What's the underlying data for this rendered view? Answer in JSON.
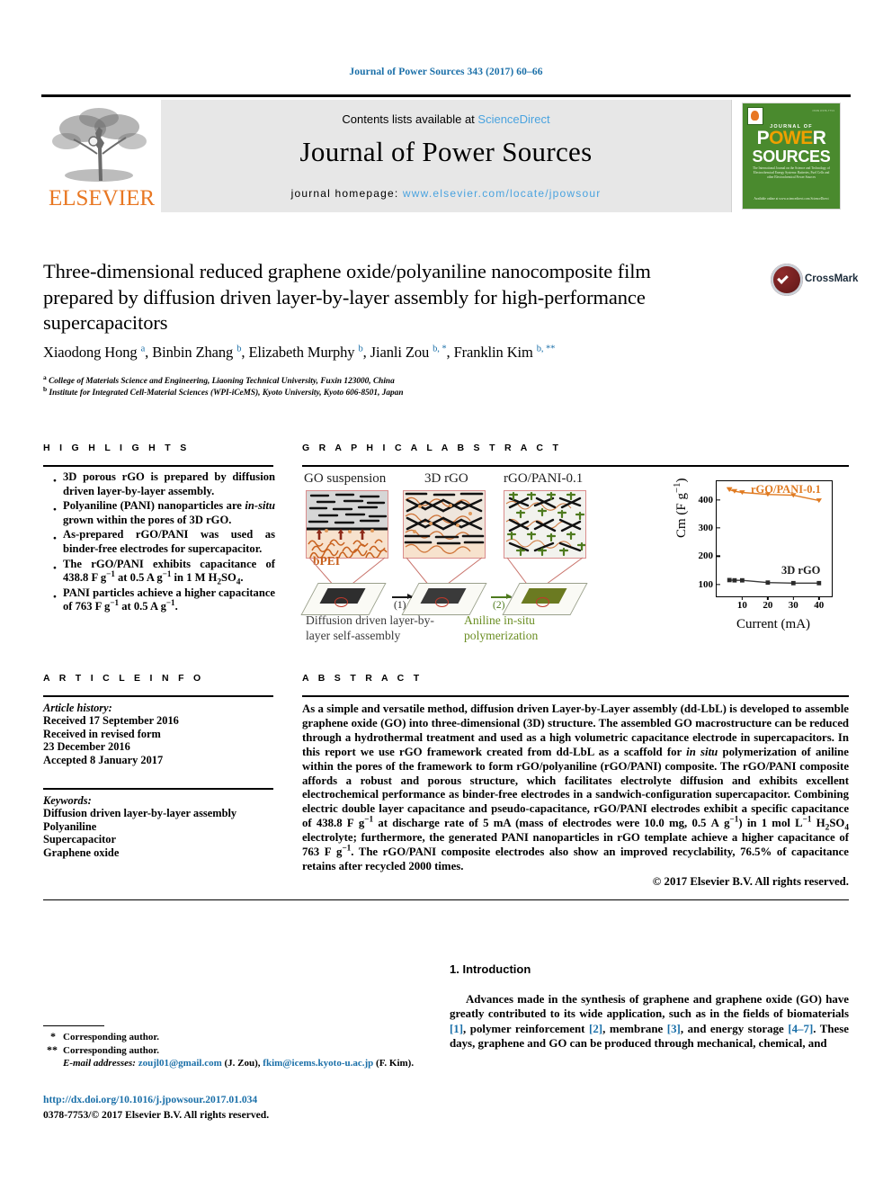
{
  "running_head": "Journal of Power Sources 343 (2017) 60–66",
  "masthead": {
    "publisher_name": "ELSEVIER",
    "contents_prefix": "Contents lists available at ",
    "contents_link": "ScienceDirect",
    "journal_title": "Journal of Power Sources",
    "homepage_prefix": "journal homepage: ",
    "homepage_url": "www.elsevier.com/locate/jpowsour",
    "cover": {
      "top_note": "ISSN 0378-7753",
      "journal_of": "JOURNAL OF",
      "power": "POWER",
      "power_w1": "P",
      "power_w2": "OWE",
      "power_w3": "R",
      "sources": "SOURCES",
      "blurb": "The International Journal on the Science and Technology of Electrochemical Energy Systems: Batteries, Fuel Cells and other Electrochemical Power Sources",
      "foot": "Available online at www.sciencedirect.com ScienceDirect"
    }
  },
  "article": {
    "title": "Three-dimensional reduced graphene oxide/polyaniline nanocomposite film prepared by diffusion driven layer-by-layer assembly for high-performance supercapacitors",
    "authors_html": "Xiaodong Hong <sup>a</sup>, Binbin Zhang <sup>b</sup>, Elizabeth Murphy <sup>b</sup>, Jianli Zou <sup>b, *</sup>, Franklin Kim <sup>b, **</sup>",
    "affiliation_a": "College of Materials Science and Engineering, Liaoning Technical University, Fuxin 123000, China",
    "affiliation_b": "Institute for Integrated Cell-Material Sciences (WPI-iCeMS), Kyoto University, Kyoto 606-8501, Japan",
    "crossmark_label": "CrossMark"
  },
  "sections": {
    "highlights_head": "H I G H L I G H T S",
    "graphical_abstract_head": "G R A P H I C A L   A B S T R A C T",
    "article_info_head": "A R T I C L E   I N F O",
    "abstract_head": "A B S T R A C T",
    "introduction_head": "1. Introduction"
  },
  "highlights": [
    "3D porous rGO is prepared by diffusion driven layer-by-layer assembly.",
    "Polyaniline (PANI) nanoparticles are in-situ grown within the pores of 3D rGO.",
    "As-prepared rGO/PANI was used as binder-free electrodes for supercapacitor.",
    "The rGO/PANI exhibits capacitance of 438.8 F g−1 at 0.5 A g−1 in 1 M H2SO4.",
    "PANI particles achieve a higher capacitance of 763 F g−1 at 0.5 A g−1."
  ],
  "article_info": {
    "history_label": "Article history:",
    "history": [
      "Received 17 September 2016",
      "Received in revised form",
      "23 December 2016",
      "Accepted 8 January 2017"
    ],
    "keywords_label": "Keywords:",
    "keywords": [
      "Diffusion driven layer-by-layer assembly",
      "Polyaniline",
      "Supercapacitor",
      "Graphene oxide"
    ]
  },
  "abstract": {
    "copyright": "© 2017 Elsevier B.V. All rights reserved."
  },
  "introduction": {},
  "footnotes": {
    "corresponding_1": "Corresponding author.",
    "corresponding_2": "Corresponding author.",
    "email_label": "E-mail addresses:",
    "email_1": "zoujl01@gmail.com",
    "email_1_owner": "(J. Zou),",
    "email_2": "fkim@icems.kyoto-u.ac.jp",
    "email_2_owner": "(F. Kim).",
    "doi": "http://dx.doi.org/10.1016/j.jpowsour.2017.01.034",
    "issn": "0378-7753/© 2017 Elsevier B.V. All rights reserved."
  },
  "graphical_abstract": {
    "panel_labels": [
      "GO suspension",
      "3D rGO",
      "rGO/PANI-0.1"
    ],
    "bpei_label": "bPEI",
    "step1": "(1)",
    "step2": "(2)",
    "caption_1": "Diffusion driven layer-by-layer self-assembly",
    "caption_2": "Aniline in-situ polymerization",
    "colors": {
      "rgo_pani_series": "#E07B22",
      "rgo_series": "#3a3a3a",
      "panel_border": "#d98d8d",
      "aniline_caption": "#6b8e23",
      "bpei": "#c8601c"
    }
  },
  "chart_data": {
    "type": "line",
    "title": "",
    "xlabel": "Current (mA)",
    "ylabel": "Cm (F g⁻¹)",
    "xlim": [
      0,
      45
    ],
    "ylim": [
      60,
      470
    ],
    "xticks": [
      10,
      20,
      30,
      40
    ],
    "yticks": [
      100,
      200,
      300,
      400
    ],
    "grid": false,
    "legend_position": "inline-annotation",
    "series": [
      {
        "name": "rGO/PANI-0.1",
        "color": "#E07B22",
        "marker": "triangle-down",
        "x": [
          5,
          7,
          10,
          20,
          30,
          40
        ],
        "y": [
          440,
          434,
          430,
          423,
          420,
          401
        ]
      },
      {
        "name": "3D rGO",
        "color": "#3a3a3a",
        "marker": "square",
        "x": [
          5,
          7,
          10,
          20,
          30,
          40
        ],
        "y": [
          118,
          117,
          117,
          109,
          107,
          107
        ]
      }
    ]
  }
}
